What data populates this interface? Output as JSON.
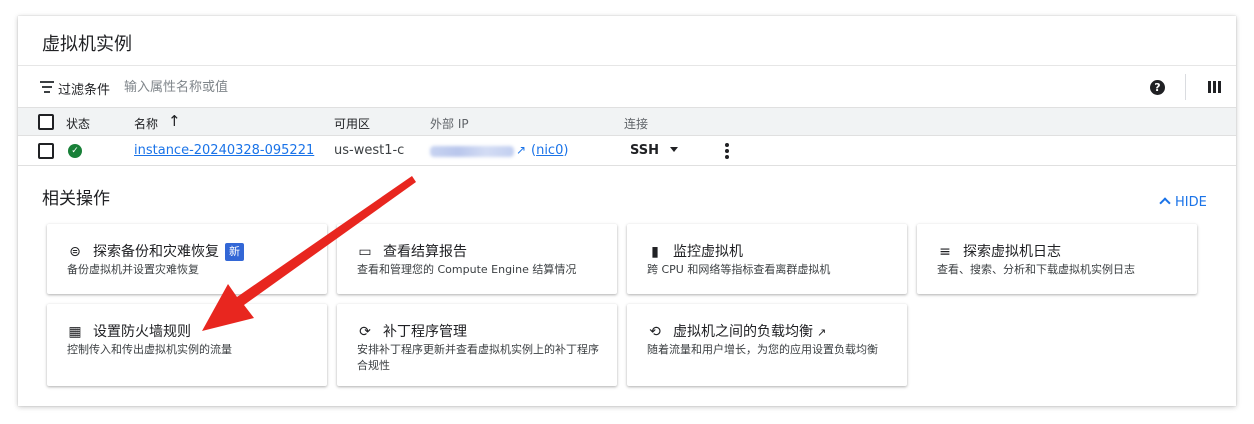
{
  "page": {
    "title": "虚拟机实例"
  },
  "filter": {
    "label": "过滤条件",
    "placeholder": "输入属性名称或值"
  },
  "toolbar": {
    "help_icon": "help-icon",
    "columns_icon": "column-display-icon",
    "help_glyph": "?"
  },
  "table": {
    "headers": {
      "status": "状态",
      "name": "名称",
      "zone": "可用区",
      "external_ip": "外部 IP",
      "connect": "连接"
    },
    "sort_arrow": "↑",
    "rows": [
      {
        "status": "running",
        "name": "instance-20240328-095221",
        "zone": "us-west1-c",
        "external_ip_blurred": true,
        "nic": "nic0",
        "connect": "SSH"
      }
    ]
  },
  "related": {
    "title": "相关操作",
    "hide_label": "HIDE",
    "tiles": [
      {
        "icon": "backup-icon",
        "glyph": "⊜",
        "title": "探索备份和灾难恢复",
        "badge": "新",
        "desc": "备份虚拟机并设置灾难恢复"
      },
      {
        "icon": "billing-card-icon",
        "glyph": "▭",
        "title": "查看结算报告",
        "desc": "查看和管理您的 Compute Engine 结算情况"
      },
      {
        "icon": "monitoring-bar-chart-icon",
        "glyph": "▮",
        "title": "监控虚拟机",
        "desc": "跨 CPU 和网络等指标查看离群虚拟机"
      },
      {
        "icon": "logs-list-icon",
        "glyph": "≡",
        "title": "探索虚拟机日志",
        "desc": "查看、搜索、分析和下载虚拟机实例日志"
      },
      {
        "icon": "firewall-icon",
        "glyph": "▦",
        "title": "设置防火墙规则",
        "desc": "控制传入和传出虚拟机实例的流量"
      },
      {
        "icon": "patch-icon",
        "glyph": "⟳",
        "title": "补丁程序管理",
        "desc": "安排补丁程序更新并查看虚拟机实例上的补丁程序合规性"
      },
      {
        "icon": "load-balancing-icon",
        "glyph": "⟲",
        "title": "虚拟机之间的负载均衡",
        "desc": "随着流量和用户增长，为您的应用设置负载均衡"
      }
    ]
  },
  "colors": {
    "link": "#1a73e8",
    "status_ok": "#188038",
    "badge": "#3367d6",
    "annotation_arrow": "#e8261f"
  }
}
